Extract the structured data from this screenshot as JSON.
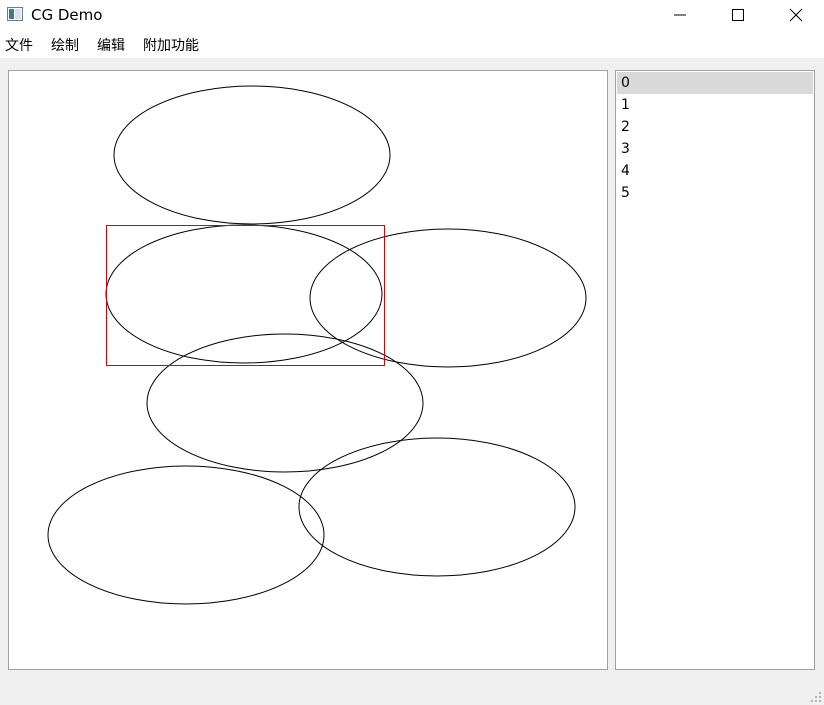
{
  "window": {
    "title": "CG Demo",
    "icon": "app-window-icon",
    "controls": [
      "minimize-icon",
      "maximize-icon",
      "close-icon"
    ]
  },
  "menu": {
    "items": [
      "文件",
      "绘制",
      "编辑",
      "附加功能"
    ]
  },
  "canvas": {
    "background": "#ffffff",
    "stroke_color": "#000000",
    "selection_color": "#e00000",
    "shapes": [
      {
        "type": "ellipse",
        "id": "0"
      },
      {
        "type": "ellipse",
        "id": "1"
      },
      {
        "type": "ellipse",
        "id": "2"
      },
      {
        "type": "ellipse",
        "id": "3"
      },
      {
        "type": "ellipse",
        "id": "4"
      },
      {
        "type": "ellipse",
        "id": "5"
      }
    ],
    "selected_id": "0"
  },
  "item_list": {
    "items": [
      "0",
      "1",
      "2",
      "3",
      "4",
      "5"
    ],
    "selected": "0",
    "selected_bg": "#d9d9d9"
  },
  "statusbar": {
    "grip_icon": "size-grip-icon"
  }
}
